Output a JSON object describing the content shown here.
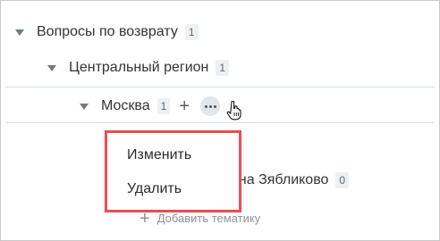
{
  "tree": {
    "root": {
      "label": "Вопросы по возврату",
      "count": "1"
    },
    "region": {
      "label": "Центральный регион",
      "count": "1"
    },
    "city": {
      "label": "Москва",
      "count": "1",
      "add_symbol": "+"
    },
    "hidden_item": {
      "label_partial": "она Зябликово",
      "count": "0"
    },
    "add_topic": {
      "symbol": "+",
      "label": "Добавить тематику"
    }
  },
  "context_menu": {
    "items": [
      "Изменить",
      "Удалить"
    ]
  },
  "colors": {
    "highlight": "#e35156",
    "divider": "#d6dee6",
    "badge_bg": "#eef1f4"
  }
}
